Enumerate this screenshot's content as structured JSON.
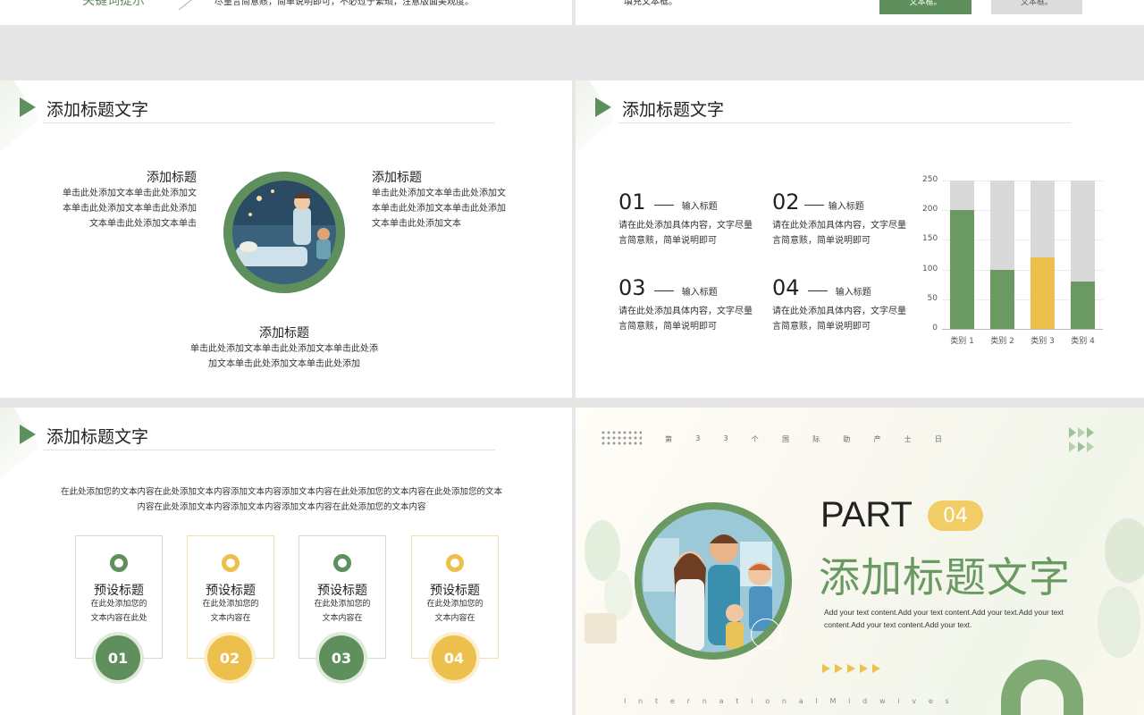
{
  "s0": {
    "left_tag": "关键词提示",
    "text": "尽量言简意赅，简单说明即可，不必过于繁琐，注意版面美观度。"
  },
  "s1": {
    "text": "填充文本框。",
    "btn_green": "文本框。",
    "btn_gray": "文本框。"
  },
  "s2": {
    "header": "添加标题文字",
    "left": {
      "title": "添加标题",
      "lines": [
        "单击此处添加文本单击此处添加文",
        "本单击此处添加文本单击此处添加",
        "文本单击此处添加文本单击"
      ]
    },
    "right": {
      "title": "添加标题",
      "lines": [
        "单击此处添加文本单击此处添加文",
        "本单击此处添加文本单击此处添加",
        "文本单击此处添加文本"
      ]
    },
    "bottom": {
      "title": "添加标题",
      "lines": [
        "单击此处添加文本单击此处添加文本单击此处添",
        "加文本单击此处添加文本单击此处添加"
      ]
    }
  },
  "s3": {
    "header": "添加标题文字",
    "items": [
      {
        "num": "01",
        "label": "输入标题",
        "lines": [
          "请在此处添加具体内容，文字尽量",
          "言简意赅，简单说明即可"
        ]
      },
      {
        "num": "02",
        "label": "输入标题",
        "lines": [
          "请在此处添加具体内容，文字尽量",
          "言简意赅，简单说明即可"
        ]
      },
      {
        "num": "03",
        "label": "输入标题",
        "lines": [
          "请在此处添加具体内容，文字尽量",
          "言简意赅，简单说明即可"
        ]
      },
      {
        "num": "04",
        "label": "输入标题",
        "lines": [
          "请在此处添加具体内容，文字尽量",
          "言简意赅，简单说明即可"
        ]
      }
    ]
  },
  "chart_data": {
    "type": "bar",
    "categories": [
      "类别 1",
      "类别 2",
      "类别 3",
      "类别 4"
    ],
    "series": [
      {
        "values": [
          200,
          100,
          120,
          80
        ]
      },
      {
        "values": [
          50,
          150,
          130,
          170
        ]
      }
    ],
    "stacked": true,
    "ylim": [
      0,
      250
    ],
    "yticks": [
      0,
      50,
      100,
      150,
      200,
      250
    ],
    "colors": {
      "base": "#6a9a62",
      "highlight": "#edc04e",
      "rest": "#d9d9d9"
    },
    "highlight_index": 2,
    "grid": true
  },
  "s4": {
    "header": "添加标题文字",
    "intro": [
      "在此处添加您的文本内容在此处添加文本内容添加文本内容添加文本内容在此处添加您的文本内容在此处添加您的文本",
      "内容在此处添加文本内容添加文本内容添加文本内容在此处添加您的文本内容"
    ],
    "cards": [
      {
        "title": "预设标题",
        "lines": [
          "在此处添加您的",
          "文本内容在此处"
        ],
        "num": "01",
        "color": "#5f8f5c"
      },
      {
        "title": "预设标题",
        "lines": [
          "在此处添加您的",
          "文本内容在"
        ],
        "num": "02",
        "color": "#edc04e"
      },
      {
        "title": "预设标题",
        "lines": [
          "在此处添加您的",
          "文本内容在"
        ],
        "num": "03",
        "color": "#5f8f5c"
      },
      {
        "title": "预设标题",
        "lines": [
          "在此处添加您的",
          "文本内容在"
        ],
        "num": "04",
        "color": "#edc04e"
      }
    ]
  },
  "s5": {
    "topline": [
      "第",
      "3",
      "3",
      "个",
      "国",
      "际",
      "助",
      "产",
      "士",
      "日"
    ],
    "part": "PART",
    "part_num": "04",
    "title": "添加标题文字",
    "body": [
      "Add your text content.Add your text content.Add your text.Add your text",
      "content.Add your text content.Add your text."
    ],
    "bottom": [
      "I",
      "n",
      "t",
      "e",
      "r",
      "n",
      "a",
      "t",
      "i",
      "o",
      "n",
      "a",
      "l",
      "M",
      "i",
      "d",
      "w",
      "i",
      "v",
      "e",
      "s"
    ]
  }
}
